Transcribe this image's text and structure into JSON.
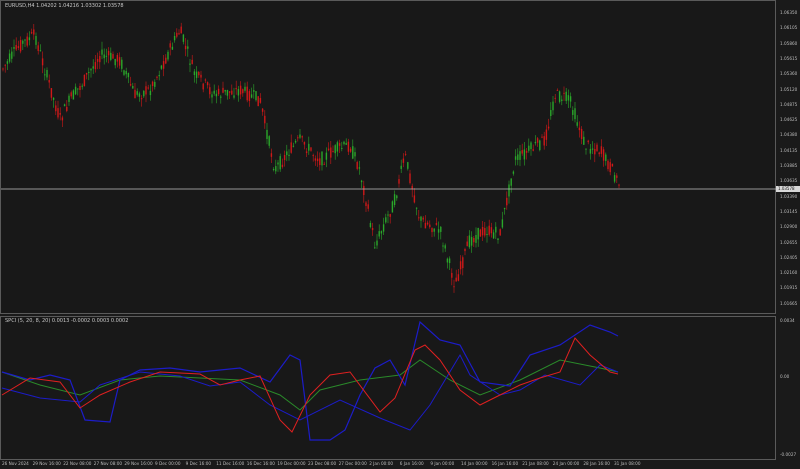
{
  "main_chart": {
    "title": "EURUSD,H4  1.04202 1.04216 1.03302 1.03578",
    "price_labels": [
      "1.06350",
      "1.06105",
      "1.05860",
      "1.05615",
      "1.05360",
      "1.05120",
      "1.04875",
      "1.04625",
      "1.04380",
      "1.04135",
      "1.03885",
      "1.03635",
      "1.03390",
      "1.03145",
      "1.02900",
      "1.02655",
      "1.02405",
      "1.02160",
      "1.01915",
      "1.01665"
    ],
    "current_price": "1.03578",
    "colors": {
      "bull": "#2aa82a",
      "bear": "#d01818",
      "line": "#c0c0c0"
    }
  },
  "indicator": {
    "title": "SPCI (5, 20, 8, 20) 0.0013 -0.0002 0.0003 0.0002",
    "scale_labels": [
      "0.0034",
      "0.00",
      "-0.0027"
    ],
    "colors": {
      "blue": "#1c1cc8",
      "red": "#e02020",
      "green": "#2a8a2a"
    }
  },
  "time_axis": [
    "26 Nov 2024",
    "29 Nov 16:00",
    "22 Nov 08:00",
    "27 Nov 08:00",
    "29 Nov 16:00",
    "9 Dec 00:00",
    "9 Dec 16:00",
    "11 Dec 16:00",
    "16 Dec 16:00",
    "19 Dec 00:00",
    "23 Dec 08:00",
    "27 Dec 00:00",
    "2 Jan 00:00",
    "6 Jan 16:00",
    "9 Jan 00:00",
    "14 Jan 00:00",
    "16 Jan 16:00",
    "21 Jan 08:00",
    "24 Jan 00:00",
    "28 Jan 16:00",
    "31 Jan 08:00"
  ]
}
